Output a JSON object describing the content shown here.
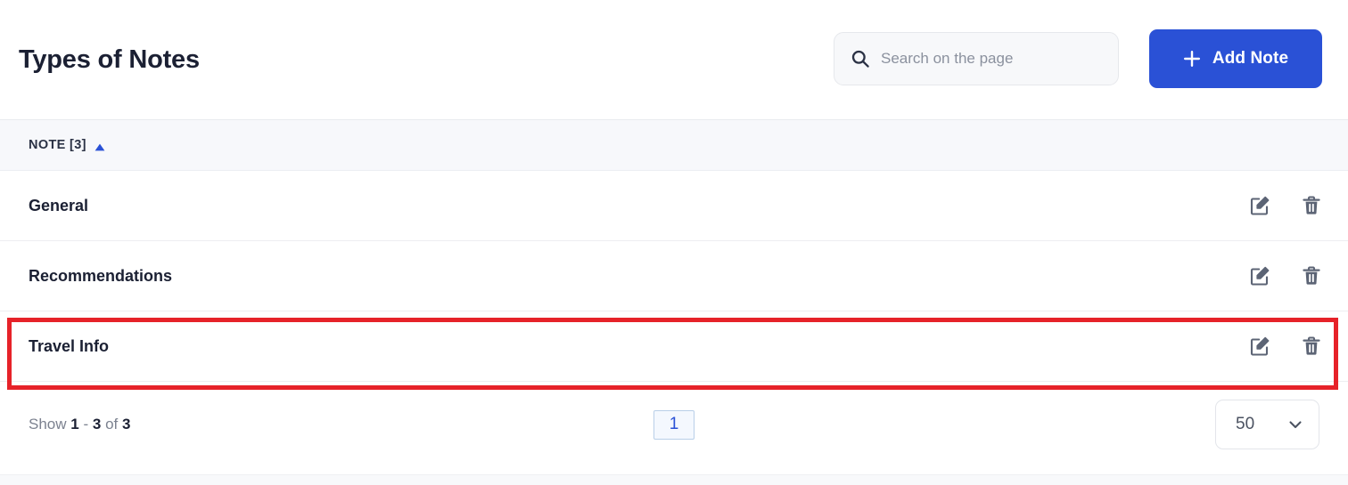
{
  "header": {
    "title": "Types of Notes",
    "search": {
      "placeholder": "Search on the page",
      "value": "",
      "icon": "search-icon"
    },
    "add_button": {
      "label": "Add Note",
      "icon": "plus-icon",
      "color": "#2a51d6"
    }
  },
  "table": {
    "columns": [
      {
        "label": "NOTE [3]",
        "sort": "ascending",
        "sort_icon": "sort-asc-icon",
        "sort_color": "#2a51d6"
      }
    ],
    "rows": [
      {
        "name": "General",
        "edit_icon": "edit-icon",
        "delete_icon": "trash-icon",
        "highlighted": false
      },
      {
        "name": "Recommendations",
        "edit_icon": "edit-icon",
        "delete_icon": "trash-icon",
        "highlighted": false
      },
      {
        "name": "Travel Info",
        "edit_icon": "edit-icon",
        "delete_icon": "trash-icon",
        "highlighted": true
      }
    ]
  },
  "annotation": {
    "color": "#e62229",
    "target": "Travel Info"
  },
  "footer": {
    "show_prefix": "Show",
    "range_start": "1",
    "range_dash": "-",
    "range_end": "3",
    "of_word": "of",
    "total": "3",
    "current_page": "1",
    "page_size": "50",
    "chevron_icon": "chevron-down-icon"
  }
}
